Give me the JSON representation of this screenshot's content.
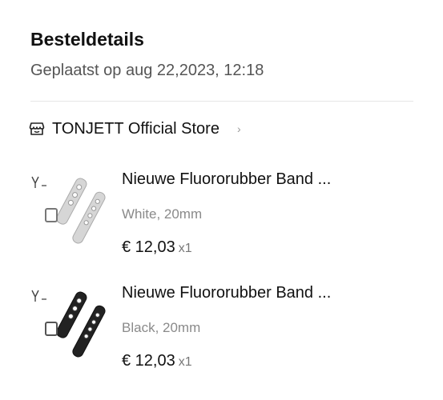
{
  "header": {
    "title": "Besteldetails",
    "placed_on": "Geplaatst op aug 22,2023, 12:18"
  },
  "store": {
    "icon": "store-icon",
    "name": "TONJETT Official Store",
    "chevron_icon": "chevron-right-icon"
  },
  "items": [
    {
      "title": "Nieuwe Fluororubber Band ...",
      "variant": "White, 20mm",
      "price": "€ 12,03",
      "quantity": "x1",
      "strap_color": "#d6d6d6"
    },
    {
      "title": "Nieuwe Fluororubber Band ...",
      "variant": "Black, 20mm",
      "price": "€ 12,03",
      "quantity": "x1",
      "strap_color": "#222222"
    }
  ]
}
